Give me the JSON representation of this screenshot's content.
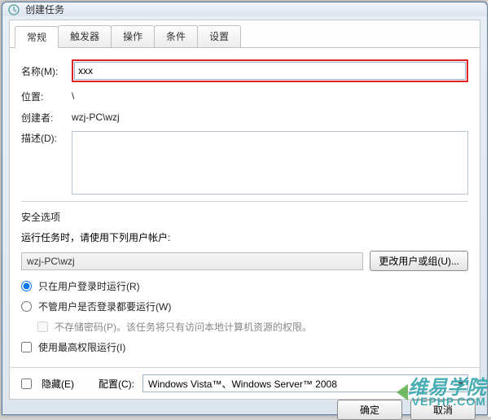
{
  "window": {
    "title": "创建任务"
  },
  "tabs": [
    "常规",
    "触发器",
    "操作",
    "条件",
    "设置"
  ],
  "fields": {
    "name_label": "名称(M):",
    "name_value": "xxx",
    "location_label": "位置:",
    "location_value": "\\",
    "creator_label": "创建者:",
    "creator_value": "wzj-PC\\wzj",
    "desc_label": "描述(D):",
    "desc_value": ""
  },
  "security": {
    "title": "安全选项",
    "run_as_label": "运行任务时，请使用下列用户帐户:",
    "account": "wzj-PC\\wzj",
    "change_user_btn": "更改用户或组(U)...",
    "radio_logged_on": "只在用户登录时运行(R)",
    "radio_any": "不管用户是否登录都要运行(W)",
    "no_password": "不存储密码(P)。该任务将只有访问本地计算机资源的权限。",
    "highest_priv": "使用最高权限运行(I)"
  },
  "bottom": {
    "hidden": "隐藏(E)",
    "config_label": "配置(C):",
    "config_value": "Windows Vista™、Windows Server™ 2008"
  },
  "footer": {
    "ok": "确定",
    "cancel": "取消"
  },
  "watermark": {
    "big": "维易学院",
    "small": "VEPHP.COM"
  }
}
